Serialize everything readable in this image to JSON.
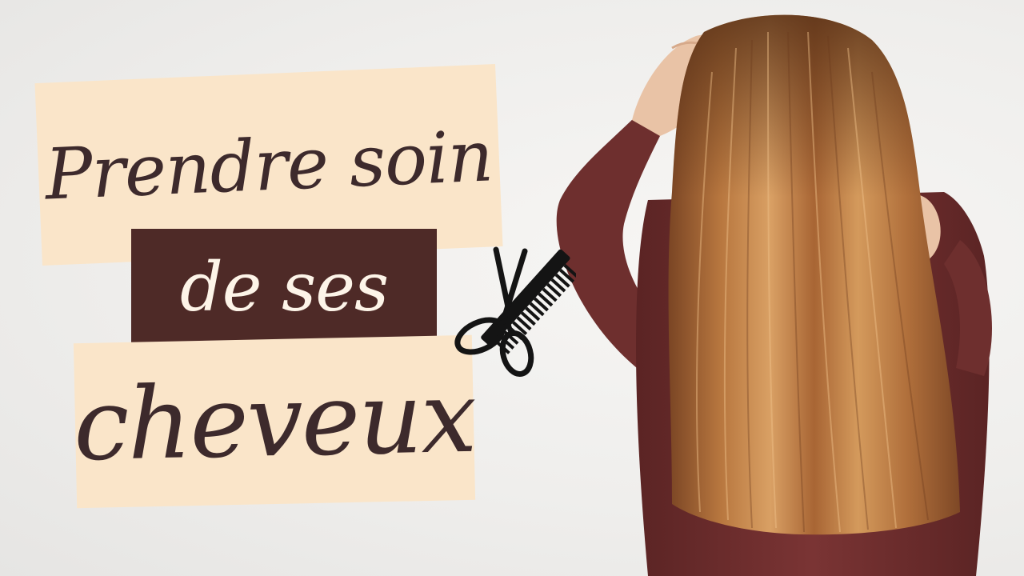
{
  "title": {
    "line1": "Prendre soin",
    "line2": "de ses",
    "line3": "cheveux"
  },
  "icons": {
    "tools": "scissors-and-comb-icon"
  },
  "photo": {
    "subject": "woman-long-hair-back-view"
  },
  "colors": {
    "panel_light": "#fae5c9",
    "panel_dark": "#4e2a27",
    "text_dark": "#3d2a2c",
    "text_light": "#fdf4e8",
    "hair": "#b47642",
    "sweater": "#6e2f2e",
    "background": "#f1f0ee"
  }
}
